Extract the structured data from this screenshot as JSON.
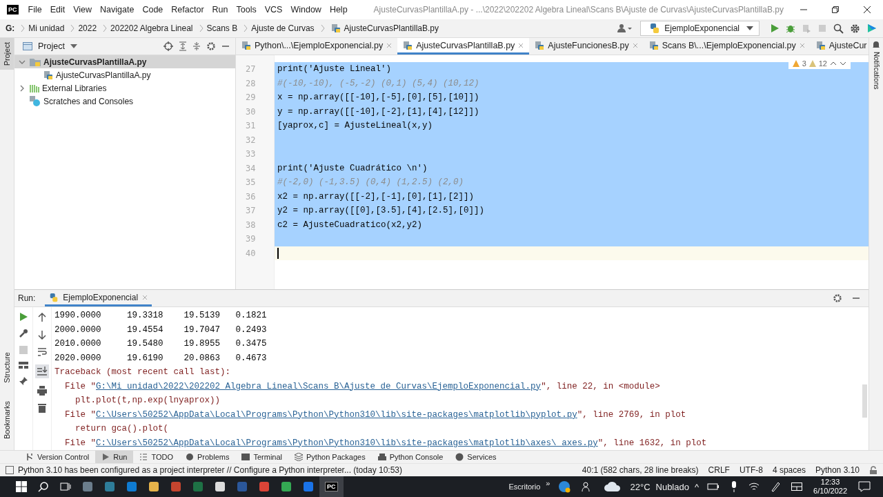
{
  "window": {
    "logo": "PC",
    "menu": [
      "File",
      "Edit",
      "View",
      "Navigate",
      "Code",
      "Refactor",
      "Run",
      "Tools",
      "VCS",
      "Window",
      "Help"
    ],
    "title": "AjusteCurvasPlantillaA.py - ...\\2022\\202202 Algebra Lineal\\Scans B\\Ajuste de Curvas\\AjusteCurvasPlantillaB.py"
  },
  "breadcrumb": [
    "G:",
    "Mi unidad",
    "2022",
    "202202 Algebra Lineal",
    "Scans B",
    "Ajuste de Curvas",
    "AjusteCurvasPlantillaB.py"
  ],
  "run_config": "EjemploExponencial",
  "left_strip": [
    {
      "label": "Project",
      "selected": true
    },
    {
      "label": "Structure",
      "selected": false
    },
    {
      "label": "Bookmarks",
      "selected": false
    }
  ],
  "right_strip": [
    "Notifications"
  ],
  "project": {
    "title": "Project",
    "tree": [
      {
        "label": "AjusteCurvasPlantillaA.py",
        "kind": "folder",
        "selected": true,
        "expanded": true,
        "children": [
          {
            "label": "AjusteCurvasPlantillaA.py",
            "kind": "file",
            "selected": false
          }
        ]
      },
      {
        "label": "External Libraries",
        "kind": "libraries",
        "selected": false,
        "expanded": false
      },
      {
        "label": "Scratches and Consoles",
        "kind": "scratches",
        "selected": false
      }
    ]
  },
  "editor": {
    "tabs": [
      {
        "label": "Python\\...\\EjemploExponencial.py",
        "selected": false
      },
      {
        "label": "AjusteCurvasPlantillaB.py",
        "selected": true
      },
      {
        "label": "AjusteFuncionesB.py",
        "selected": false
      },
      {
        "label": "Scans B\\...\\EjemploExponencial.py",
        "selected": false
      },
      {
        "label": "AjusteCur",
        "selected": false
      }
    ],
    "warnings": "3",
    "weak_warnings": "12",
    "lines": [
      {
        "number": "27",
        "kind": "code",
        "code": "print('Ajuste Lineal')",
        "selected": true
      },
      {
        "number": "28",
        "kind": "comment",
        "code": "#(-10,-10), (-5,-2) (0,1) (5,4) (10,12)",
        "selected": true
      },
      {
        "number": "29",
        "kind": "code",
        "code": "x = np.array([[-10],[-5],[0],[5],[10]])",
        "selected": true
      },
      {
        "number": "30",
        "kind": "code",
        "code": "y = np.array([[-10],[-2],[1],[4],[12]])",
        "selected": true
      },
      {
        "number": "31",
        "kind": "code",
        "code": "[yaprox,c] = AjusteLineal(x,y)",
        "selected": true
      },
      {
        "number": "32",
        "selected": true
      },
      {
        "number": "33",
        "selected": true
      },
      {
        "number": "34",
        "kind": "code",
        "code": "print('Ajuste Cuadrático \\n')",
        "selected": true
      },
      {
        "number": "35",
        "kind": "comment",
        "code": "#(-2,0) (-1,3.5) (0,4) (1,2.5) (2,0)",
        "selected": true
      },
      {
        "number": "36",
        "kind": "code",
        "code": "x2 = np.array([[-2],[-1],[0],[1],[2]])",
        "selected": true
      },
      {
        "number": "37",
        "kind": "code",
        "code": "y2 = np.array([[0],[3.5],[4],[2.5],[0]])",
        "selected": true
      },
      {
        "number": "38",
        "kind": "code",
        "code": "c2 = AjusteCuadratico(x2,y2)",
        "selected": true
      },
      {
        "number": "39",
        "selected": true
      },
      {
        "number": "40",
        "selected": false
      }
    ]
  },
  "run": {
    "label": "Run:",
    "tab": "EjemploExponencial",
    "output": [
      {
        "kind": "text",
        "text": "1990.0000     19.3318    19.5139   0.1821"
      },
      {
        "kind": "text",
        "text": "2000.0000     19.4554    19.7047   0.2493"
      },
      {
        "kind": "text",
        "text": "2010.0000     19.5480    19.8955   0.3475"
      },
      {
        "kind": "text",
        "text": "2020.0000     19.6190    20.0863   0.4673"
      },
      {
        "kind": "error",
        "text": "Traceback (most recent call last):"
      },
      {
        "kind": "file",
        "prefix": "  File \"",
        "link": "G:\\Mi unidad\\2022\\202202 Algebra Lineal\\Scans B\\Ajuste de Curvas\\EjemploExponencial.py",
        "suffix": "\", line 22, in <module>"
      },
      {
        "kind": "error",
        "text": "    plt.plot(t,np.exp(lnyaprox))"
      },
      {
        "kind": "file",
        "prefix": "  File \"",
        "link": "C:\\Users\\50252\\AppData\\Local\\Programs\\Python\\Python310\\lib\\site-packages\\matplotlib\\pyplot.py",
        "suffix": "\", line 2769, in plot"
      },
      {
        "kind": "error",
        "text": "    return gca().plot("
      },
      {
        "kind": "file",
        "prefix": "  File \"",
        "link": "C:\\Users\\50252\\AppData\\Local\\Programs\\Python\\Python310\\lib\\site-packages\\matplotlib\\axes\\_axes.py",
        "suffix": "\", line 1632, in plot"
      }
    ]
  },
  "tool_tabs": [
    {
      "label": "Version Control",
      "kind": "vcs",
      "selected": false
    },
    {
      "label": "Run",
      "kind": "run",
      "selected": true
    },
    {
      "label": "TODO",
      "kind": "todo",
      "selected": false
    },
    {
      "label": "Problems",
      "kind": "problems",
      "selected": false
    },
    {
      "label": "Terminal",
      "kind": "terminal",
      "selected": false
    },
    {
      "label": "Python Packages",
      "kind": "packages",
      "selected": false
    },
    {
      "label": "Python Console",
      "kind": "console",
      "selected": false
    },
    {
      "label": "Services",
      "kind": "services",
      "selected": false
    }
  ],
  "status_bar": {
    "message": "Python 3.10 has been configured as a project interpreter // Configure a Python interpreter... (today 10:53)",
    "items": [
      "40:1 (582 chars, 28 line breaks)",
      "CRLF",
      "UTF-8",
      "4 spaces",
      "Python 3.10"
    ]
  },
  "taskbar": {
    "active_app": "PC",
    "desktop": "Escritorio",
    "more": "»",
    "temperature": "22°C",
    "weather": "Nublado",
    "tray_arrow": "^",
    "time": "12:33",
    "date": "6/10/2022"
  }
}
